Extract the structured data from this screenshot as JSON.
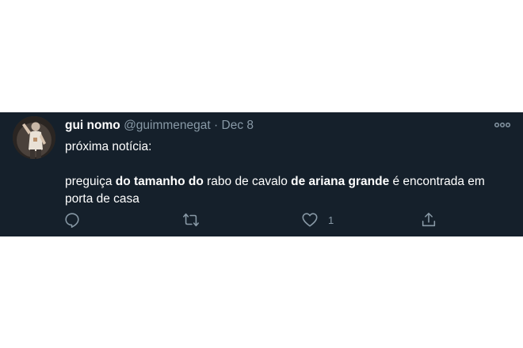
{
  "tweet": {
    "author_name": "gui nomo",
    "handle": "@guimmenegat",
    "separator": "·",
    "date": "Dec 8",
    "line1": "próxima notícia:",
    "body": [
      {
        "text": "preguiça ",
        "bold": false
      },
      {
        "text": "do tamanho do",
        "bold": true
      },
      {
        "text": " rabo de cavalo ",
        "bold": false
      },
      {
        "text": "de ariana grande",
        "bold": true
      },
      {
        "text": " é encontrada em porta de casa",
        "bold": false
      }
    ],
    "reply_count": "",
    "retweet_count": "",
    "like_count": "1"
  },
  "icons": {
    "more": "more-horizontal-icon",
    "reply": "reply-icon",
    "retweet": "retweet-icon",
    "like": "heart-icon",
    "share": "share-icon"
  },
  "colors": {
    "background": "#15202b",
    "text": "#ffffff",
    "secondary": "#8899a6"
  }
}
